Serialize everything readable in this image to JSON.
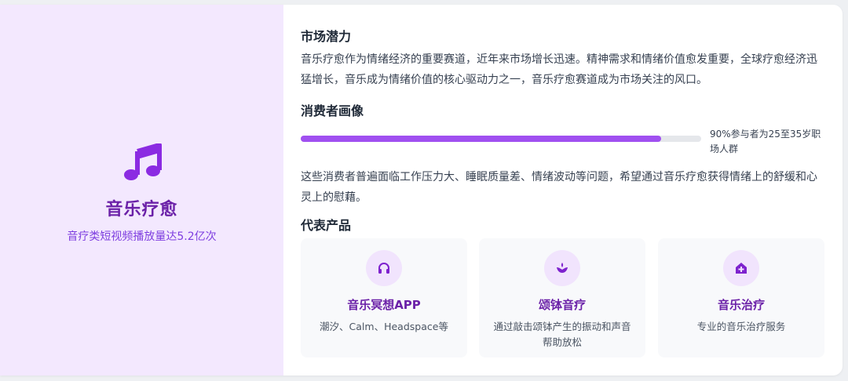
{
  "colors": {
    "accent": "#9a3df0",
    "title_purple": "#6b21a8",
    "panel_bg": "#f3e8fe"
  },
  "left": {
    "icon": "music-note-icon",
    "title": "音乐疗愈",
    "subtitle": "音疗类短视频播放量达5.2亿次"
  },
  "market": {
    "title": "市场潜力",
    "text": "音乐疗愈作为情绪经济的重要赛道，近年来市场增长迅速。精神需求和情绪价值愈发重要，全球疗愈经济迅猛增长，音乐成为情绪价值的核心驱动力之一，音乐疗愈赛道成为市场关注的风口。"
  },
  "consumer": {
    "title": "消费者画像",
    "progress_percent": 90,
    "progress_label": "90%参与者为25至35岁职场人群",
    "text": "这些消费者普遍面临工作压力大、睡眠质量差、情绪波动等问题，希望通过音乐疗愈获得情绪上的舒缓和心灵上的慰藉。"
  },
  "products": {
    "title": "代表产品",
    "items": [
      {
        "icon": "headphones-icon",
        "name": "音乐冥想APP",
        "desc": "潮汐、Calm、Headspace等"
      },
      {
        "icon": "singing-bowl-icon",
        "name": "颂钵音疗",
        "desc": "通过敲击颂钵产生的振动和声音帮助放松"
      },
      {
        "icon": "clinic-plus-icon",
        "name": "音乐治疗",
        "desc": "专业的音乐治疗服务"
      }
    ]
  }
}
